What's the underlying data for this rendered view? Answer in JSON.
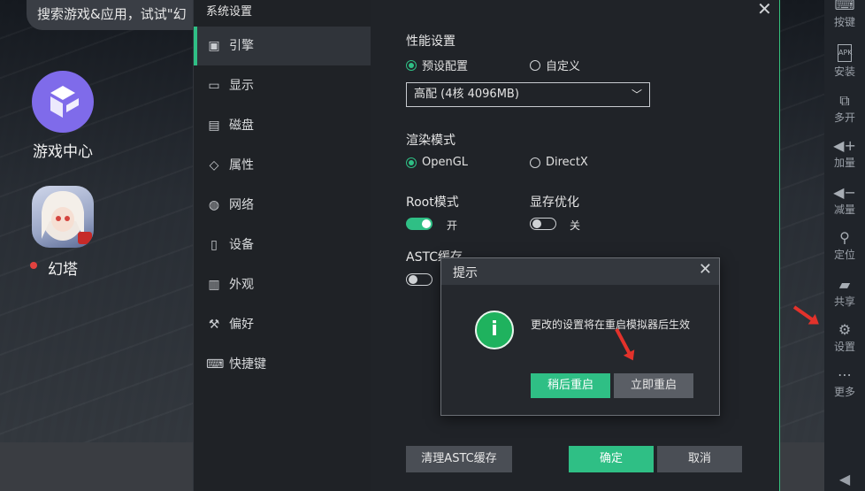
{
  "desktop": {
    "search_text": "搜索游戏&应用，试试\"幻",
    "apps": [
      {
        "label": "游戏中心"
      },
      {
        "label": "幻塔"
      }
    ]
  },
  "toolbar": {
    "items": [
      {
        "label": "按键",
        "icon": "keyboard-icon"
      },
      {
        "label": "安装",
        "icon": "apk-icon"
      },
      {
        "label": "多开",
        "icon": "multi-instance-icon"
      },
      {
        "label": "加量",
        "icon": "volume-up-icon"
      },
      {
        "label": "减量",
        "icon": "volume-down-icon"
      },
      {
        "label": "定位",
        "icon": "location-icon"
      },
      {
        "label": "共享",
        "icon": "folder-icon"
      },
      {
        "label": "设置",
        "icon": "gear-icon"
      },
      {
        "label": "更多",
        "icon": "more-icon"
      }
    ],
    "apk_glyph": "APK"
  },
  "settings": {
    "title": "系统设置",
    "nav": [
      {
        "label": "引擎",
        "icon": "chip-icon",
        "active": true
      },
      {
        "label": "显示",
        "icon": "monitor-icon",
        "active": false
      },
      {
        "label": "磁盘",
        "icon": "disk-icon",
        "active": false
      },
      {
        "label": "属性",
        "icon": "tag-icon",
        "active": false
      },
      {
        "label": "网络",
        "icon": "globe-icon",
        "active": false
      },
      {
        "label": "设备",
        "icon": "device-icon",
        "active": false
      },
      {
        "label": "外观",
        "icon": "window-icon",
        "active": false
      },
      {
        "label": "偏好",
        "icon": "wrench-icon",
        "active": false
      },
      {
        "label": "快捷键",
        "icon": "keyboard-icon",
        "active": false
      }
    ],
    "performance": {
      "label": "性能设置",
      "options": [
        "预设配置",
        "自定义"
      ],
      "selected": "预设配置",
      "select_value": "高配 (4核 4096MB)"
    },
    "render": {
      "label": "渲染模式",
      "options": [
        "OpenGL",
        "DirectX"
      ],
      "selected": "OpenGL"
    },
    "root": {
      "label": "Root模式",
      "state_text": "开",
      "on": true
    },
    "vram": {
      "label": "显存优化",
      "state_text": "关",
      "on": false
    },
    "astc": {
      "label": "ASTC缓存",
      "on": false
    },
    "buttons": {
      "clear_astc": "清理ASTC缓存",
      "confirm": "确定",
      "cancel": "取消"
    },
    "colors": {
      "accent": "#2fbf85"
    }
  },
  "dialog": {
    "title": "提示",
    "message": "更改的设置将在重启模拟器后生效",
    "icon_glyph": "i",
    "buttons": {
      "later": "稍后重启",
      "now": "立即重启"
    }
  }
}
